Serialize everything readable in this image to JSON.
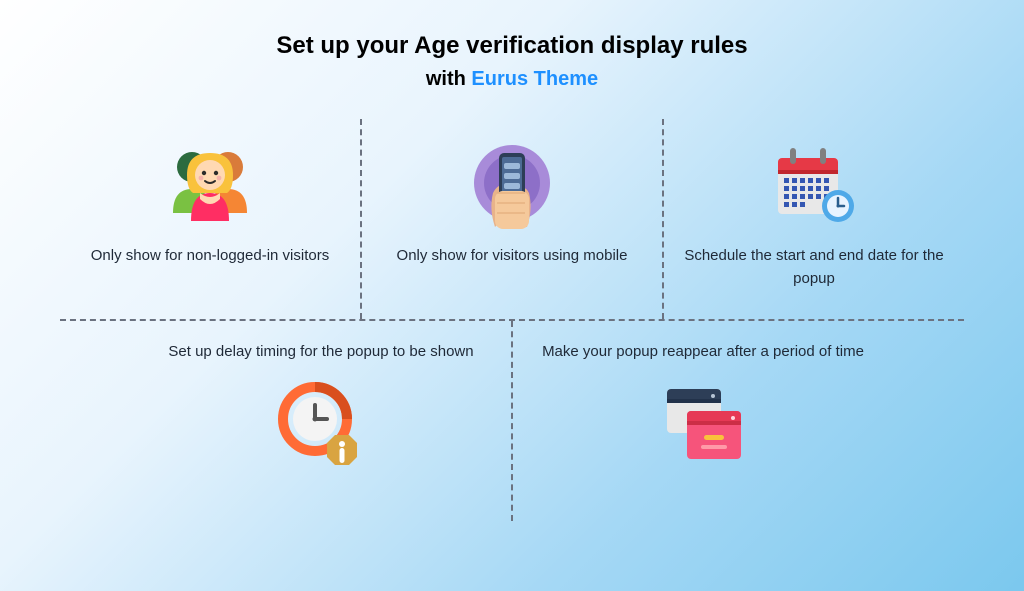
{
  "header": {
    "title": "Set up your Age verification display rules",
    "subtitle_prefix": "with ",
    "subtitle_brand": "Eurus Theme"
  },
  "features": [
    {
      "caption": "Only show for non-logged-in visitors"
    },
    {
      "caption": "Only show for visitors using mobile"
    },
    {
      "caption": "Schedule the start and end date for the popup"
    },
    {
      "caption": "Set up delay timing for the popup to be shown"
    },
    {
      "caption": "Make your popup reappear after a period of time"
    }
  ]
}
